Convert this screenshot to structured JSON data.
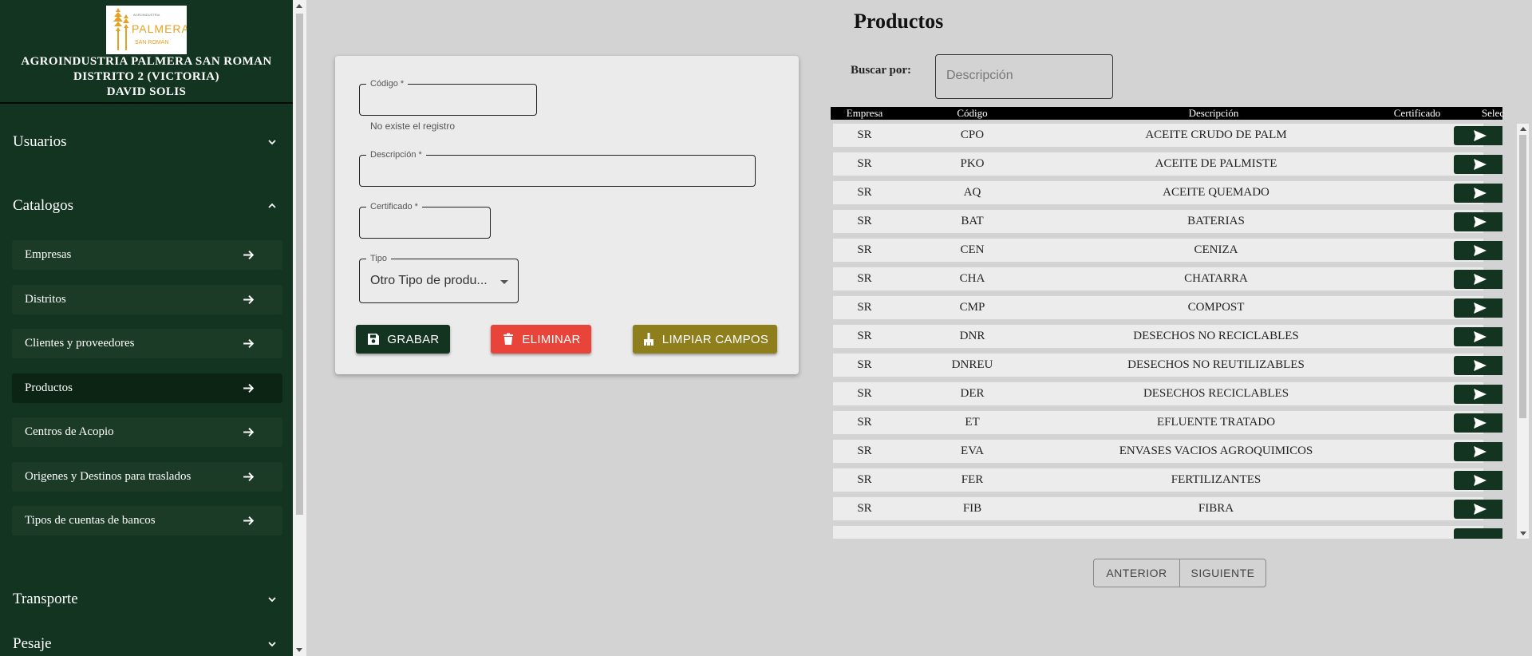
{
  "sidebar": {
    "org_name": "AGROINDUSTRIA PALMERA SAN ROMAN",
    "district": "DISTRITO 2 (VICTORIA)",
    "user": "DAVID SOLIS",
    "logo": {
      "top": "AGROINDUSTRIA",
      "main": "PALMERA",
      "bottom": "SAN ROMÁN"
    },
    "sections": [
      {
        "label": "Usuarios",
        "icon": "chevron-down-icon"
      },
      {
        "label": "Catalogos",
        "icon": "chevron-up-icon"
      },
      {
        "label": "Transporte",
        "icon": "chevron-down-icon"
      },
      {
        "label": "Pesaje",
        "icon": "chevron-down-icon"
      }
    ],
    "catalog_items": [
      {
        "label": "Empresas"
      },
      {
        "label": "Distritos"
      },
      {
        "label": "Clientes y proveedores"
      },
      {
        "label": "Productos",
        "active": true
      },
      {
        "label": "Centros de Acopio"
      },
      {
        "label": "Origenes y Destinos para traslados"
      },
      {
        "label": "Tipos de cuentas de bancos"
      }
    ]
  },
  "form": {
    "codigo_label": "Código *",
    "codigo_value": "",
    "codigo_helper": "No existe el registro",
    "descripcion_label": "Descripción *",
    "descripcion_value": "",
    "certificado_label": "Certificado *",
    "certificado_value": "",
    "tipo_label": "Tipo",
    "tipo_value": "Otro Tipo de produ...",
    "save_label": "GRABAR",
    "delete_label": "ELIMINAR",
    "clear_label": "LIMPIAR CAMPOS"
  },
  "main": {
    "title": "Productos",
    "search_label": "Buscar por:",
    "search_placeholder": "Descripción",
    "search_value": ""
  },
  "table": {
    "headers": [
      "Empresa",
      "Código",
      "Descripción",
      "Certificado",
      "Selec"
    ],
    "rows": [
      {
        "empresa": "SR",
        "codigo": "CPO",
        "descripcion": "ACEITE CRUDO DE PALM",
        "certificado": ""
      },
      {
        "empresa": "SR",
        "codigo": "PKO",
        "descripcion": "ACEITE DE PALMISTE",
        "certificado": ""
      },
      {
        "empresa": "SR",
        "codigo": "AQ",
        "descripcion": "ACEITE QUEMADO",
        "certificado": ""
      },
      {
        "empresa": "SR",
        "codigo": "BAT",
        "descripcion": "BATERIAS",
        "certificado": ""
      },
      {
        "empresa": "SR",
        "codigo": "CEN",
        "descripcion": "CENIZA",
        "certificado": ""
      },
      {
        "empresa": "SR",
        "codigo": "CHA",
        "descripcion": "CHATARRA",
        "certificado": ""
      },
      {
        "empresa": "SR",
        "codigo": "CMP",
        "descripcion": "COMPOST",
        "certificado": ""
      },
      {
        "empresa": "SR",
        "codigo": "DNR",
        "descripcion": "DESECHOS NO RECICLABLES",
        "certificado": ""
      },
      {
        "empresa": "SR",
        "codigo": "DNREU",
        "descripcion": "DESECHOS NO REUTILIZABLES",
        "certificado": ""
      },
      {
        "empresa": "SR",
        "codigo": "DER",
        "descripcion": "DESECHOS RECICLABLES",
        "certificado": ""
      },
      {
        "empresa": "SR",
        "codigo": "ET",
        "descripcion": "EFLUENTE TRATADO",
        "certificado": ""
      },
      {
        "empresa": "SR",
        "codigo": "EVA",
        "descripcion": "ENVASES VACIOS AGROQUIMICOS",
        "certificado": ""
      },
      {
        "empresa": "SR",
        "codigo": "FER",
        "descripcion": "FERTILIZANTES",
        "certificado": ""
      },
      {
        "empresa": "SR",
        "codigo": "FIB",
        "descripcion": "FIBRA",
        "certificado": ""
      }
    ]
  },
  "pager": {
    "prev_label": "ANTERIOR",
    "next_label": "SIGUIENTE"
  },
  "colors": {
    "sidebar_bg": "#123420",
    "save_button": "#123420",
    "delete_button": "#e8443a",
    "clear_button": "#8f7e1c",
    "select_button": "#123420"
  }
}
